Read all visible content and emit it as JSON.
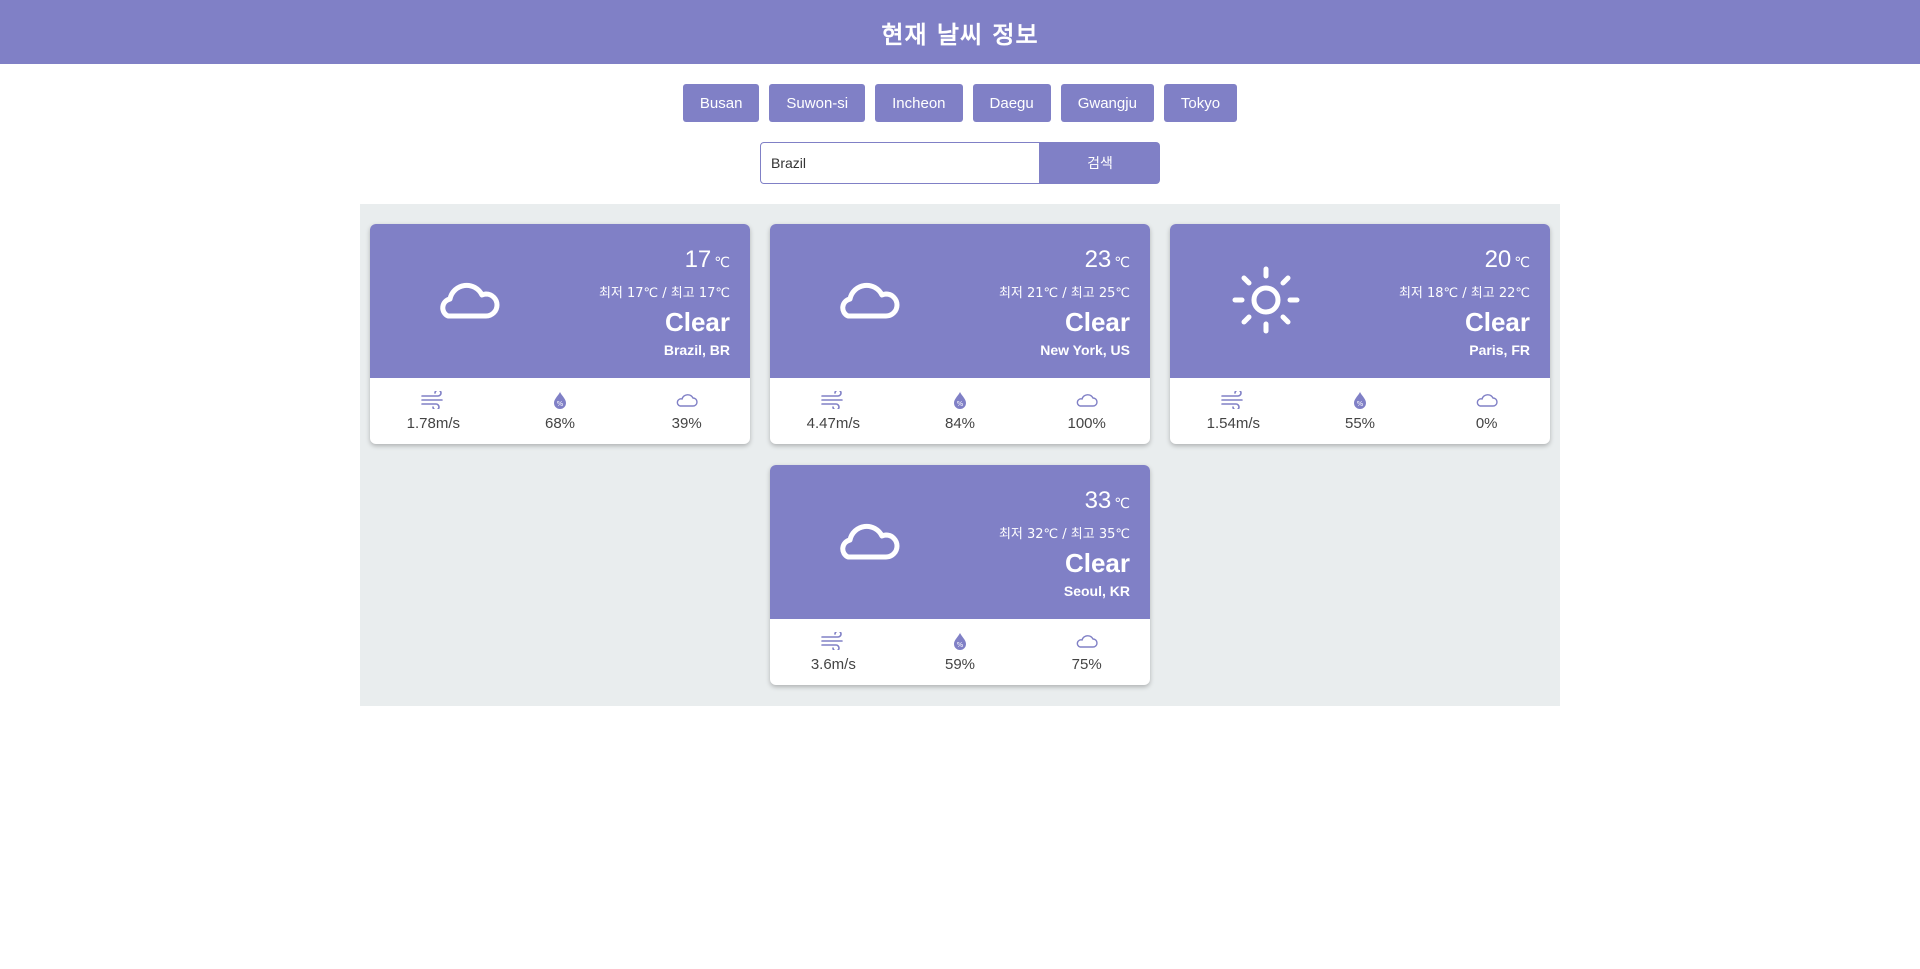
{
  "header": {
    "title": "현재 날씨 정보"
  },
  "city_buttons": [
    "Busan",
    "Suwon-si",
    "Incheon",
    "Daegu",
    "Gwangju",
    "Tokyo"
  ],
  "search": {
    "value": "Brazil",
    "button_label": "검색"
  },
  "cards": [
    {
      "icon": "cloud-icon",
      "temp": "17",
      "unit": "℃",
      "minmax": "최저 17℃ / 최고 17℃",
      "desc": "Clear",
      "place": "Brazil, BR",
      "wind": "1.78m/s",
      "humidity": "68%",
      "clouds": "39%"
    },
    {
      "icon": "cloud-icon",
      "temp": "23",
      "unit": "℃",
      "minmax": "최저 21℃ / 최고 25℃",
      "desc": "Clear",
      "place": "New York, US",
      "wind": "4.47m/s",
      "humidity": "84%",
      "clouds": "100%"
    },
    {
      "icon": "sun-icon",
      "temp": "20",
      "unit": "℃",
      "minmax": "최저 18℃ / 최고 22℃",
      "desc": "Clear",
      "place": "Paris, FR",
      "wind": "1.54m/s",
      "humidity": "55%",
      "clouds": "0%"
    },
    {
      "icon": "cloud-icon",
      "temp": "33",
      "unit": "℃",
      "minmax": "최저 32℃ / 최고 35℃",
      "desc": "Clear",
      "place": "Seoul, KR",
      "wind": "3.6m/s",
      "humidity": "59%",
      "clouds": "75%"
    }
  ],
  "colors": {
    "accent": "#8080c6",
    "panel": "#e9edee"
  }
}
